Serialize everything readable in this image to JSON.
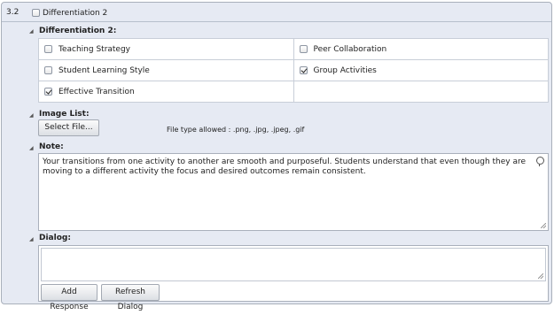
{
  "section": {
    "number": "3.2",
    "title": "Differentiation 2",
    "checked": false
  },
  "differentiation": {
    "heading": "Differentiation 2:",
    "options": [
      {
        "label": "Teaching Strategy",
        "checked": false
      },
      {
        "label": "Peer Collaboration",
        "checked": false
      },
      {
        "label": "Student Learning Style",
        "checked": false
      },
      {
        "label": "Group Activities",
        "checked": true
      },
      {
        "label": "Effective Transition",
        "checked": true
      }
    ]
  },
  "image_list": {
    "heading": "Image List:",
    "select_button": "Select File...",
    "file_types": "File type allowed : .png, .jpg, .jpeg, .gif"
  },
  "note": {
    "heading": "Note:",
    "text": "Your transitions from one activity to another are smooth and purposeful. Students understand that even though they are moving to a different activity the focus and desired outcomes remain consistent."
  },
  "dialog": {
    "heading": "Dialog:",
    "value": "",
    "add_button": "Add Response",
    "refresh_button": "Refresh Dialog"
  }
}
